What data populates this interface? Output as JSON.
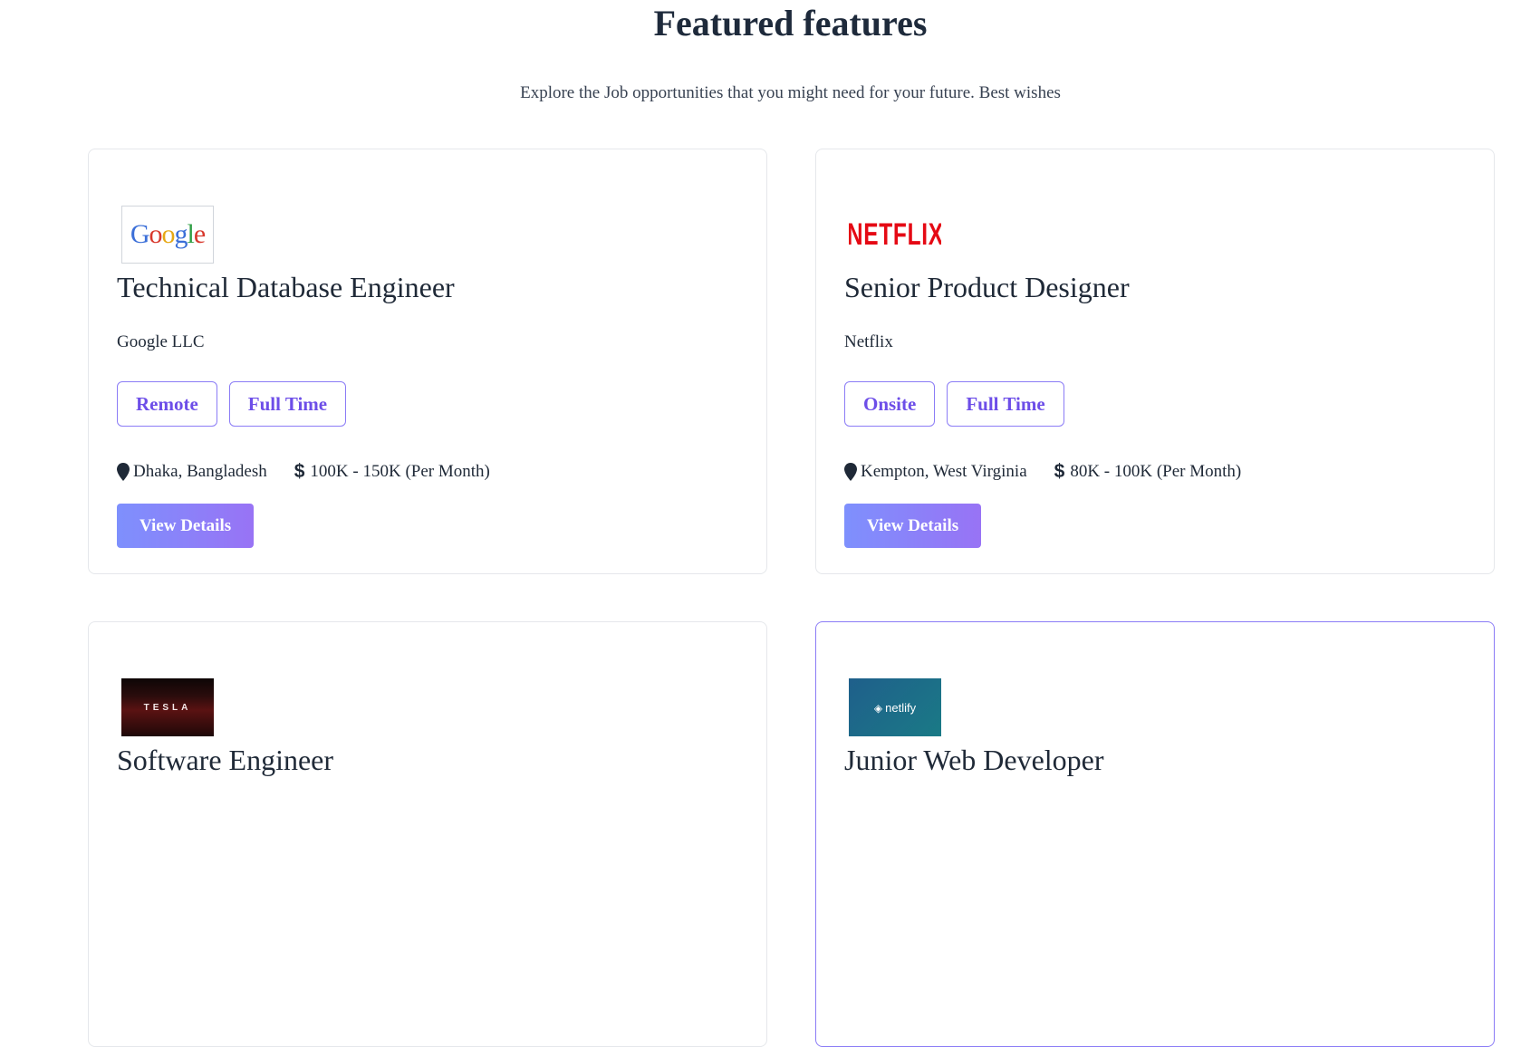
{
  "section": {
    "title": "Featured features",
    "subtitle": "Explore the Job opportunities that you might need for your future. Best wishes"
  },
  "jobs": [
    {
      "logo": "Google",
      "title": "Technical Database Engineer",
      "company": "Google LLC",
      "tags": [
        "Remote",
        "Full Time"
      ],
      "location": "Dhaka, Bangladesh",
      "salary": "100K - 150K (Per Month)",
      "button": "View Details"
    },
    {
      "logo": "NETFLIX",
      "title": "Senior Product Designer",
      "company": "Netflix",
      "tags": [
        "Onsite",
        "Full Time"
      ],
      "location": "Kempton, West Virginia",
      "salary": "80K - 100K (Per Month)",
      "button": "View Details"
    },
    {
      "logo": "TESLA",
      "title": "Software Engineer"
    },
    {
      "logo": "netlify",
      "title": "Junior Web Developer"
    }
  ],
  "icons": {
    "location": "map-pin-icon",
    "salary": "dollar-icon"
  },
  "colors": {
    "accent": "#8b7cf6",
    "tag_text": "#6d4ee8",
    "button_start": "#7e90fd",
    "button_end": "#9873f5",
    "heading": "#1e2a3b"
  }
}
